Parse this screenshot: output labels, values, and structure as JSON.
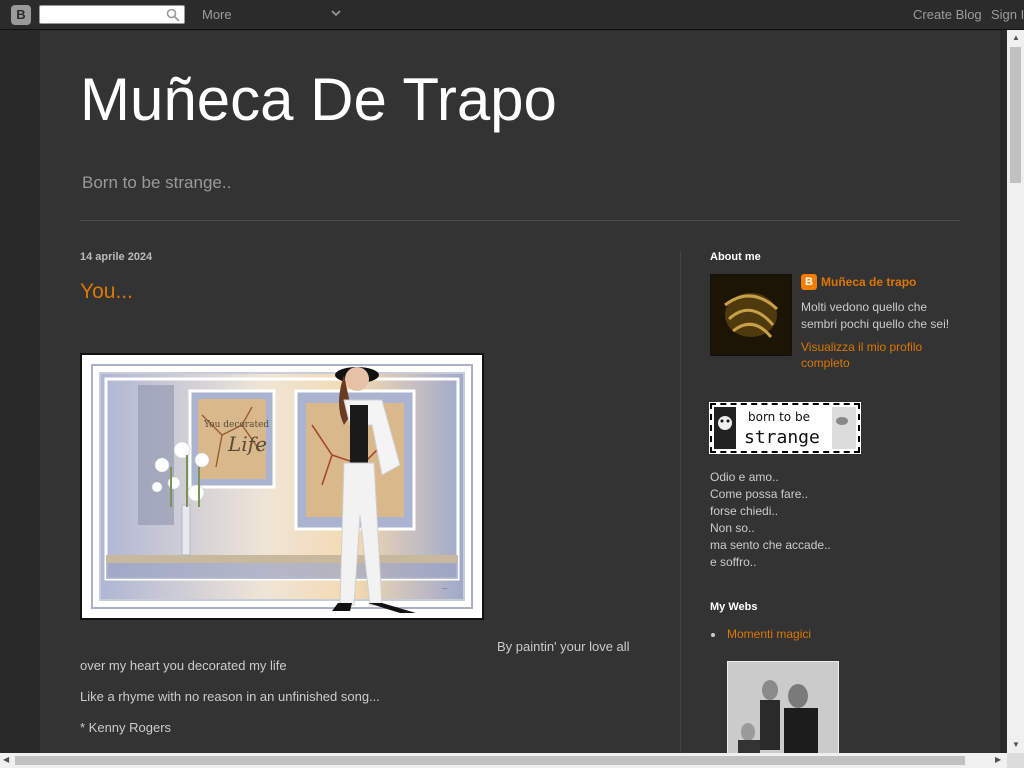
{
  "navbar": {
    "search_placeholder": "",
    "more_label": "More",
    "create_blog_label": "Create Blog",
    "sign_in_label": "Sign In"
  },
  "header": {
    "title": "Muñeca De Trapo",
    "description": "Born to be strange.."
  },
  "post": {
    "date": "14 aprile 2024",
    "title": "You...",
    "image_caption": "You decorated my Life",
    "lines": [
      "By paintin' your love all",
      "over my heart you decorated my life",
      "Like a rhyme with no reason in an unfinished song...",
      "* Kenny Rogers"
    ]
  },
  "sidebar": {
    "about_title": "About me",
    "profile_name": "Muñeca de trapo",
    "profile_desc": "Molti vedono quello che sembri pochi quello che sei!",
    "profile_link": "Visualizza il mio profilo completo",
    "badge_text_1": "born to be",
    "badge_text_2": "strange",
    "poem": [
      "Odio e amo..",
      "Come possa fare..",
      "forse chiedi..",
      "Non so..",
      "ma sento che accade..",
      "e soffro.."
    ],
    "webs_title": "My Webs",
    "webs_items": [
      "Momenti magici"
    ]
  },
  "colors": {
    "link": "#dd7700",
    "background": "#292929",
    "content_background": "#333333",
    "title": "#ffffff"
  }
}
